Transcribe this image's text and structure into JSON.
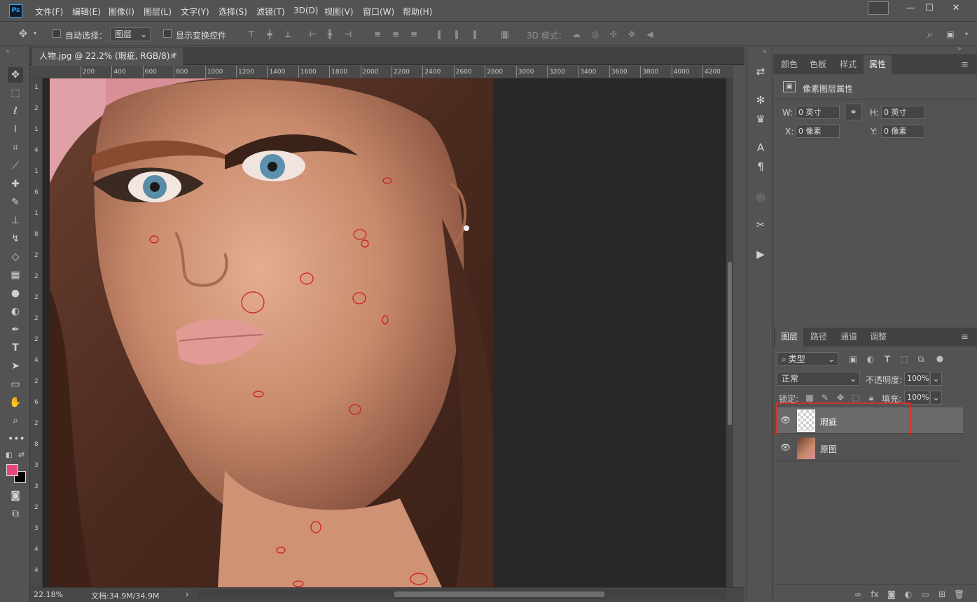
{
  "app": {
    "logo": "Ps"
  },
  "menu": [
    "文件(F)",
    "编辑(E)",
    "图像(I)",
    "图层(L)",
    "文字(Y)",
    "选择(S)",
    "滤镜(T)",
    "3D(D)",
    "视图(V)",
    "窗口(W)",
    "帮助(H)"
  ],
  "window_controls": {
    "minimize": "—",
    "maximize": "☐",
    "close": "✕"
  },
  "options": {
    "auto_select_label": "自动选择：",
    "auto_select_target": "图层",
    "show_transform_label": "显示变换控件",
    "mode_3d_label": "3D 模式："
  },
  "document": {
    "tab_title": "人物.jpg @ 22.2% (瑕疵, RGB/8) *",
    "close_glyph": "×"
  },
  "ruler": {
    "top": [
      "200",
      "400",
      "600",
      "800",
      "1000",
      "1200",
      "1400",
      "1600",
      "1800",
      "2000",
      "2200",
      "2400",
      "2600",
      "2800",
      "3000",
      "3200",
      "3400",
      "3600",
      "3800",
      "4000",
      "4200"
    ],
    "left": [
      "1",
      "2",
      "1",
      "4",
      "1",
      "6",
      "1",
      "8",
      "2",
      "2",
      "2",
      "2",
      "2",
      "4",
      "2",
      "6",
      "2",
      "8",
      "3",
      "3",
      "2",
      "3",
      "4",
      "4"
    ]
  },
  "status": {
    "zoom": "22.18%",
    "doc_size": "文档:34.9M/34.9M",
    "arrow": "›"
  },
  "props_panel": {
    "tabs": [
      "颜色",
      "色板",
      "样式",
      "属性"
    ],
    "active_tab": "属性",
    "title": "像素图层属性",
    "w_label": "W:",
    "w_value": "0 英寸",
    "h_label": "H:",
    "h_value": "0 英寸",
    "x_label": "X:",
    "x_value": "0 像素",
    "y_label": "Y:",
    "y_value": "0 像素"
  },
  "layers_panel": {
    "tabs": [
      "图层",
      "路径",
      "通道",
      "调整"
    ],
    "active_tab": "图层",
    "filter_kind": "类型",
    "blend_mode": "正常",
    "opacity_label": "不透明度:",
    "opacity_value": "100%",
    "lock_label": "锁定:",
    "fill_label": "填充:",
    "fill_value": "100%",
    "layers": [
      {
        "name": "瑕疵",
        "selected": true
      },
      {
        "name": "原图",
        "selected": false
      }
    ]
  },
  "colors": {
    "foreground": "#e8457f",
    "background": "#000000",
    "highlight_box": "#d0322e",
    "blemish_circle": "#d01818"
  },
  "icons": [
    "move-icon",
    "marquee-icon",
    "lasso-icon",
    "quick-select-icon",
    "crop-icon",
    "eyedropper-icon",
    "healing-brush-icon",
    "brush-icon",
    "clone-stamp-icon",
    "history-brush-icon",
    "eraser-icon",
    "gradient-icon",
    "blur-icon",
    "dodge-icon",
    "pen-icon",
    "type-icon",
    "path-select-icon",
    "shape-icon",
    "hand-icon",
    "zoom-icon",
    "more-tools-icon"
  ]
}
